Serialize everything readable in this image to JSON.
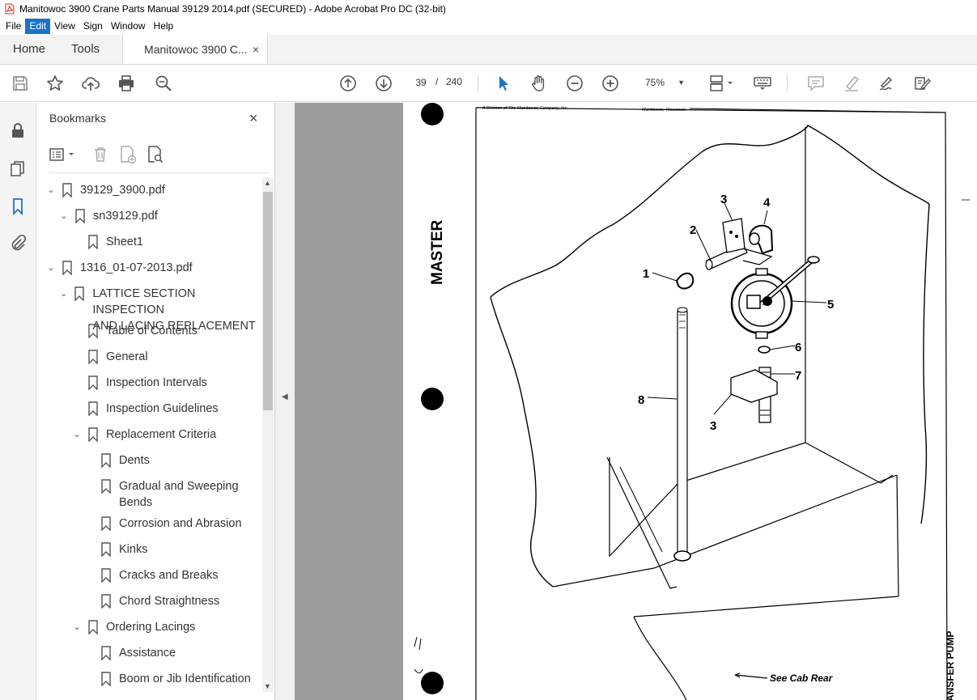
{
  "window": {
    "title": "Manitowoc 3900 Crane Parts Manual 39129 2014.pdf (SECURED) - Adobe Acrobat Pro DC (32-bit)"
  },
  "menu": {
    "items": [
      "File",
      "Edit",
      "View",
      "Sign",
      "Window",
      "Help"
    ],
    "active": "Edit"
  },
  "tabs": {
    "home": "Home",
    "tools": "Tools",
    "document": "Manitowoc 3900 C...",
    "close_symbol": "×"
  },
  "toolbar": {
    "current_page": "39",
    "page_separator": "/",
    "total_pages": "240",
    "zoom": "75%",
    "icons": [
      "save-icon",
      "star-icon",
      "upload-icon",
      "print-icon",
      "search-zoom-icon",
      "prev-page-icon",
      "next-page-icon",
      "select-arrow-icon",
      "hand-icon",
      "zoom-out-icon",
      "zoom-in-icon",
      "page-view-icon",
      "keyboard-icon",
      "comment-icon",
      "highlight-icon",
      "sign-icon",
      "fill-sign-icon"
    ]
  },
  "bookmarks": {
    "header": "Bookmarks",
    "close_symbol": "×",
    "items": [
      {
        "label": "39129_3900.pdf",
        "level": 0,
        "expanded": true
      },
      {
        "label": "sn39129.pdf",
        "level": 1,
        "expanded": true
      },
      {
        "label": "Sheet1",
        "level": 2,
        "expanded": null
      },
      {
        "label": "1316_01-07-2013.pdf",
        "level": 0,
        "expanded": true
      },
      {
        "label": "LATTICE SECTION INSPECTION",
        "label2": "AND LACING REPLACEMENT",
        "level": 1,
        "expanded": true
      },
      {
        "label": "Table of Contents",
        "level": 2,
        "expanded": null
      },
      {
        "label": "General",
        "level": 2,
        "expanded": null
      },
      {
        "label": "Inspection Intervals",
        "level": 2,
        "expanded": null
      },
      {
        "label": "Inspection Guidelines",
        "level": 2,
        "expanded": null
      },
      {
        "label": "Replacement Criteria",
        "level": 2,
        "expanded": true
      },
      {
        "label": "Dents",
        "level": 3,
        "expanded": null
      },
      {
        "label": "Gradual and Sweeping",
        "label2": "Bends",
        "level": 3,
        "expanded": null
      },
      {
        "label": "Corrosion and Abrasion",
        "level": 3,
        "expanded": null
      },
      {
        "label": "Kinks",
        "level": 3,
        "expanded": null
      },
      {
        "label": "Cracks and Breaks",
        "level": 3,
        "expanded": null
      },
      {
        "label": "Chord Straightness",
        "level": 3,
        "expanded": null
      },
      {
        "label": "Ordering Lacings",
        "level": 2,
        "expanded": true
      },
      {
        "label": "Assistance",
        "level": 3,
        "expanded": null
      },
      {
        "label": "Boom or Jib Identification",
        "level": 3,
        "expanded": null
      }
    ]
  },
  "document_page": {
    "header_left": "A Division of The Manitowoc Company, Inc.",
    "header_right": "Manitowoc, Wisconsin",
    "side_stamp": "MASTER",
    "right_edge_text": "ANSFER PUMP",
    "bottom_callout": "See Cab Rear",
    "part_numbers": [
      "1",
      "2",
      "3",
      "4",
      "5",
      "6",
      "7",
      "8",
      "3"
    ]
  },
  "colors": {
    "accent": "#1a73c9",
    "select_tool": "#1a73c9",
    "viewport_bg": "#9c9c9c"
  }
}
